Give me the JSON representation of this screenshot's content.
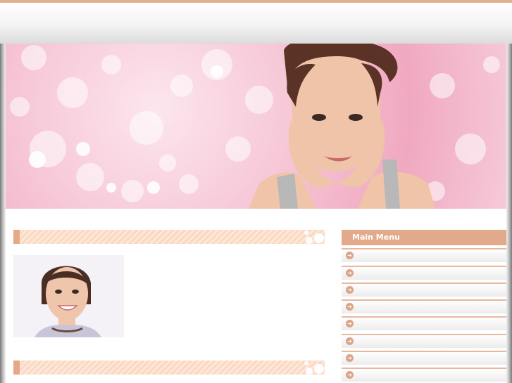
{
  "header": {
    "brand_color": "#e3b08f"
  },
  "content": {
    "top_link": "",
    "section_titles": [
      "",
      ""
    ]
  },
  "sidebar": {
    "heading": "Main Menu",
    "items": [
      {
        "label": ""
      },
      {
        "label": ""
      },
      {
        "label": ""
      },
      {
        "label": ""
      },
      {
        "label": ""
      },
      {
        "label": ""
      },
      {
        "label": ""
      },
      {
        "label": ""
      }
    ]
  },
  "colors": {
    "accent": "#e2aa8a",
    "link": "#2a4dd0"
  }
}
